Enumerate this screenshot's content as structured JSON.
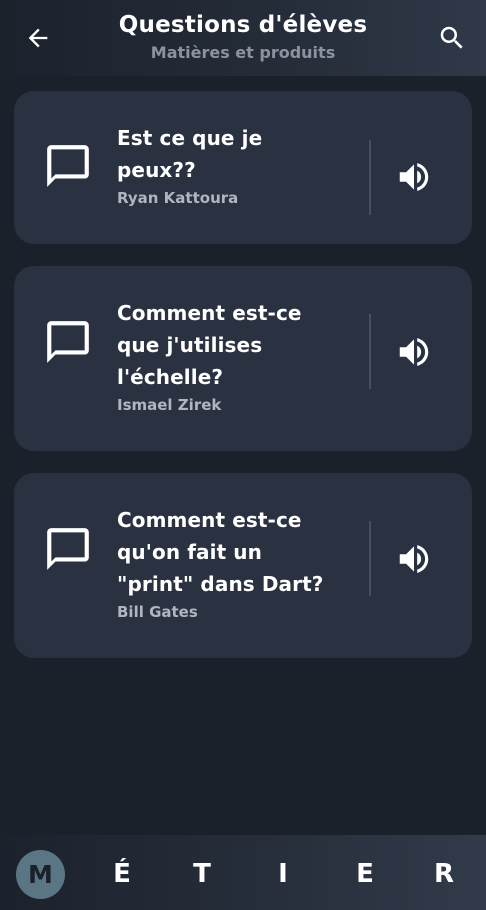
{
  "header": {
    "title": "Questions d'élèves",
    "subtitle": "Matières et produits",
    "back_icon": "arrow-left-icon",
    "search_icon": "search-icon"
  },
  "questions": [
    {
      "title_lines": [
        "Est ce que je",
        "peux??"
      ],
      "author": "Ryan Kattoura"
    },
    {
      "title_lines": [
        "Comment est-ce",
        "que j'utilises",
        "l'échelle?"
      ],
      "author": "Ismael Zirek"
    },
    {
      "title_lines": [
        "Comment est-ce",
        "qu'on fait un",
        "\"print\" dans Dart?"
      ],
      "author": "Bill Gates"
    }
  ],
  "brand": {
    "letters": [
      "M",
      "É",
      "T",
      "I",
      "E",
      "R"
    ]
  },
  "colors": {
    "background": "#1b212b",
    "card": "#2a3140",
    "brand_circle": "#5a7685",
    "muted_text": "#8c939e"
  }
}
